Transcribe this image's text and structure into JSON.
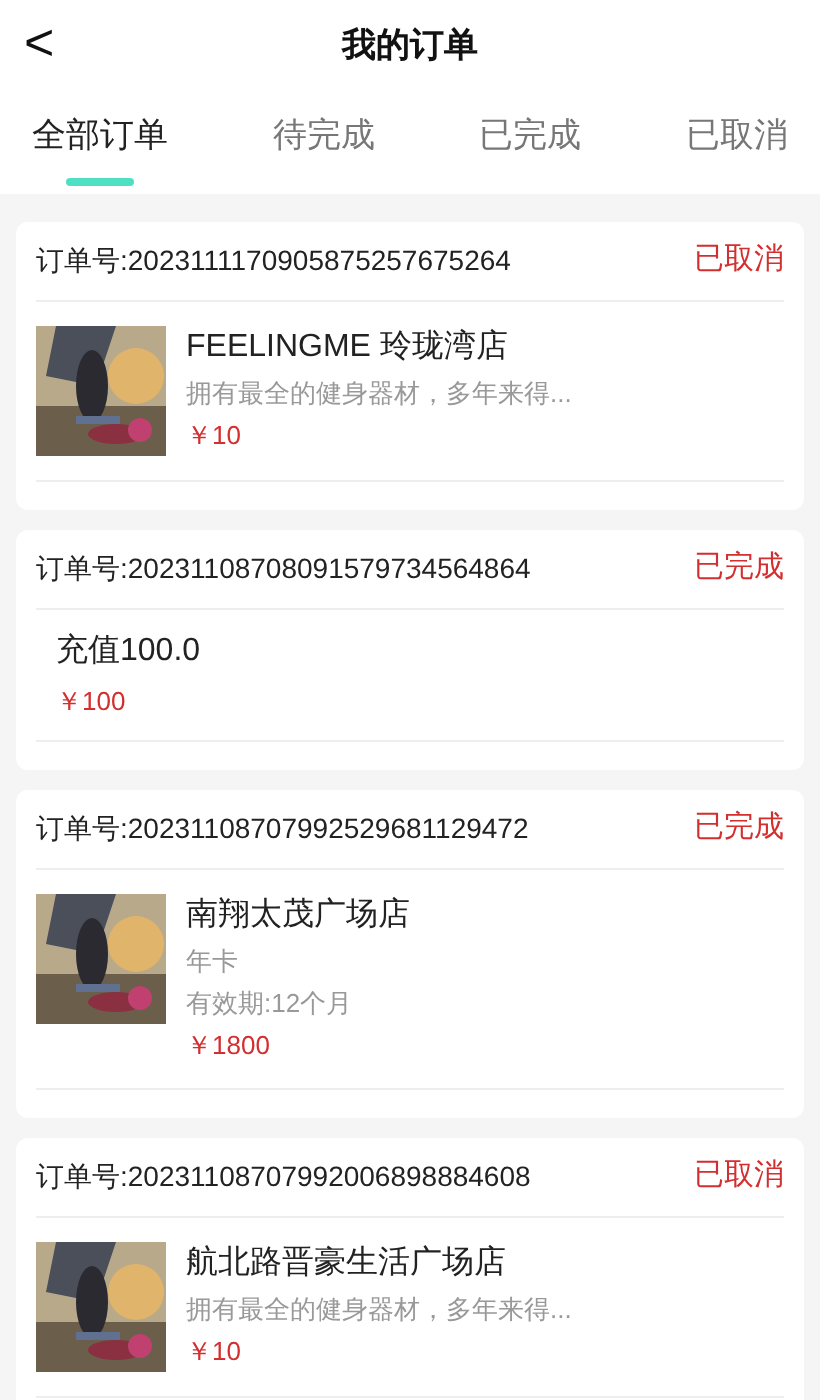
{
  "header": {
    "back": "<",
    "title": "我的订单"
  },
  "tabs": [
    {
      "label": "全部订单",
      "selected": true
    },
    {
      "label": "待完成",
      "selected": false
    },
    {
      "label": "已完成",
      "selected": false
    },
    {
      "label": "已取消",
      "selected": false
    }
  ],
  "orders": [
    {
      "order_no": "订单号:2023111170905875257675264",
      "status": "已取消",
      "item": {
        "kind": "store",
        "name": "FEELINGME 玲珑湾店",
        "lines": [
          "拥有最全的健身器材，多年来得..."
        ],
        "price": "￥10"
      }
    },
    {
      "order_no": "订单号:20231108708091579734564864",
      "status": "已完成",
      "item": {
        "kind": "recharge",
        "name": "充值100.0",
        "price": "￥100"
      }
    },
    {
      "order_no": "订单号:20231108707992529681129472",
      "status": "已完成",
      "item": {
        "kind": "store",
        "name": "南翔太茂广场店",
        "lines": [
          "年卡",
          "有效期:12个月"
        ],
        "price": "￥1800"
      }
    },
    {
      "order_no": "订单号:20231108707992006898884608",
      "status": "已取消",
      "item": {
        "kind": "store",
        "name": "航北路晋豪生活广场店",
        "lines": [
          "拥有最全的健身器材，多年来得..."
        ],
        "price": "￥10"
      }
    }
  ]
}
